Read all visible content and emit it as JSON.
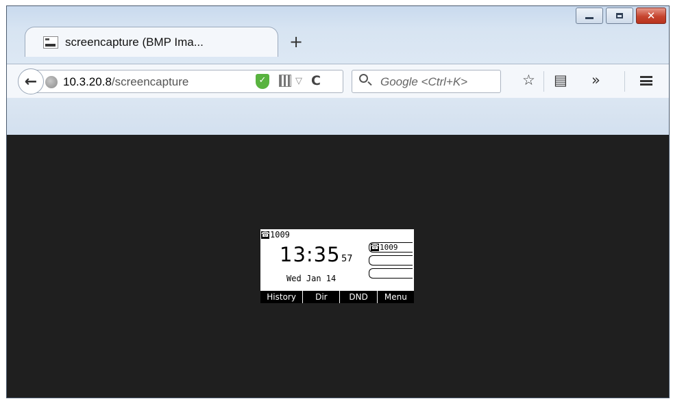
{
  "window": {
    "controls": {
      "minimize": "minimize",
      "maximize": "maximize",
      "close": "✕"
    }
  },
  "tab": {
    "title": "screencapture (BMP Ima...",
    "new_tab": "+"
  },
  "nav": {
    "back": "←",
    "url_host": "10.3.20.8",
    "url_path": "/screencapture",
    "shield": "✓",
    "dropdown": "▽",
    "reload": "C",
    "search_placeholder": "Google <Ctrl+K>",
    "bookmark_star": "☆",
    "reading_list": "▤",
    "overflow": "»"
  },
  "phone_screen": {
    "account": "1009",
    "time": "13:35",
    "seconds": "57",
    "date": "Wed Jan 14",
    "lines": [
      "1009",
      "",
      ""
    ],
    "softkeys": [
      "History",
      "Dir",
      "DND",
      "Menu"
    ]
  }
}
